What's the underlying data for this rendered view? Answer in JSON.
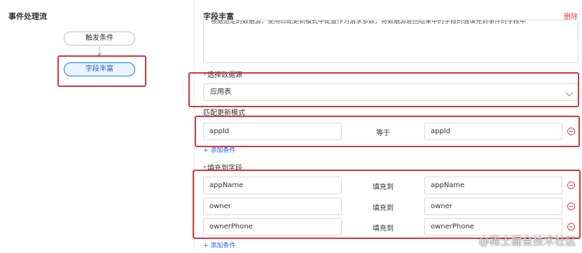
{
  "left_panel": {
    "title": "事件处理流",
    "nodes": [
      {
        "label": "触发条件"
      },
      {
        "label": "字段丰富"
      }
    ]
  },
  "right_panel": {
    "title": "字段丰富",
    "delete_label": "删除",
    "description": "根据选定的数据源，使用匹配更新模式中配置作为请求参数，将数据源返回结果中的字段的值填充到事件的字段中",
    "data_source": {
      "label": "选择数据源",
      "value": "应用表"
    },
    "match_mode": {
      "label": "匹配更新模式",
      "rows": [
        {
          "left": "appId",
          "op": "等于",
          "right": "appId"
        }
      ],
      "add_label": "+ 添加条件"
    },
    "fill_fields": {
      "label": "填充到字段",
      "rows": [
        {
          "left": "appName",
          "op": "填充到",
          "right": "appName"
        },
        {
          "left": "owner",
          "op": "填充到",
          "right": "owner"
        },
        {
          "left": "ownerPhone",
          "op": "填充到",
          "right": "ownerPhone"
        }
      ],
      "add_label": "+ 添加条件"
    }
  },
  "watermark": "@稀土掘金技术社区",
  "colors": {
    "highlight": "#d0373f",
    "accent": "#1677ff",
    "danger": "#e0404a"
  }
}
